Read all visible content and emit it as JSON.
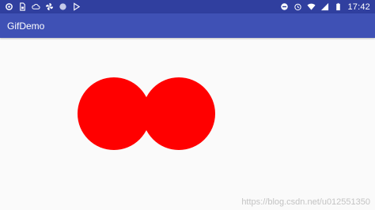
{
  "status_bar": {
    "time": "17:42",
    "left_icons": [
      "sync-icon",
      "sim-card-icon",
      "cloud-icon",
      "pinwheel-icon",
      "circle-icon",
      "play-store-icon"
    ],
    "right_icons": [
      "do-not-disturb-icon",
      "alarm-icon",
      "wifi-icon",
      "signal-icon",
      "battery-icon"
    ],
    "bar_color": "#303f9f"
  },
  "app_bar": {
    "title": "GifDemo",
    "color": "#3f51b5"
  },
  "content": {
    "circle_color": "#ff0000",
    "background": "#fafafa"
  },
  "watermark": {
    "text": "https://blog.csdn.net/u012551350"
  }
}
